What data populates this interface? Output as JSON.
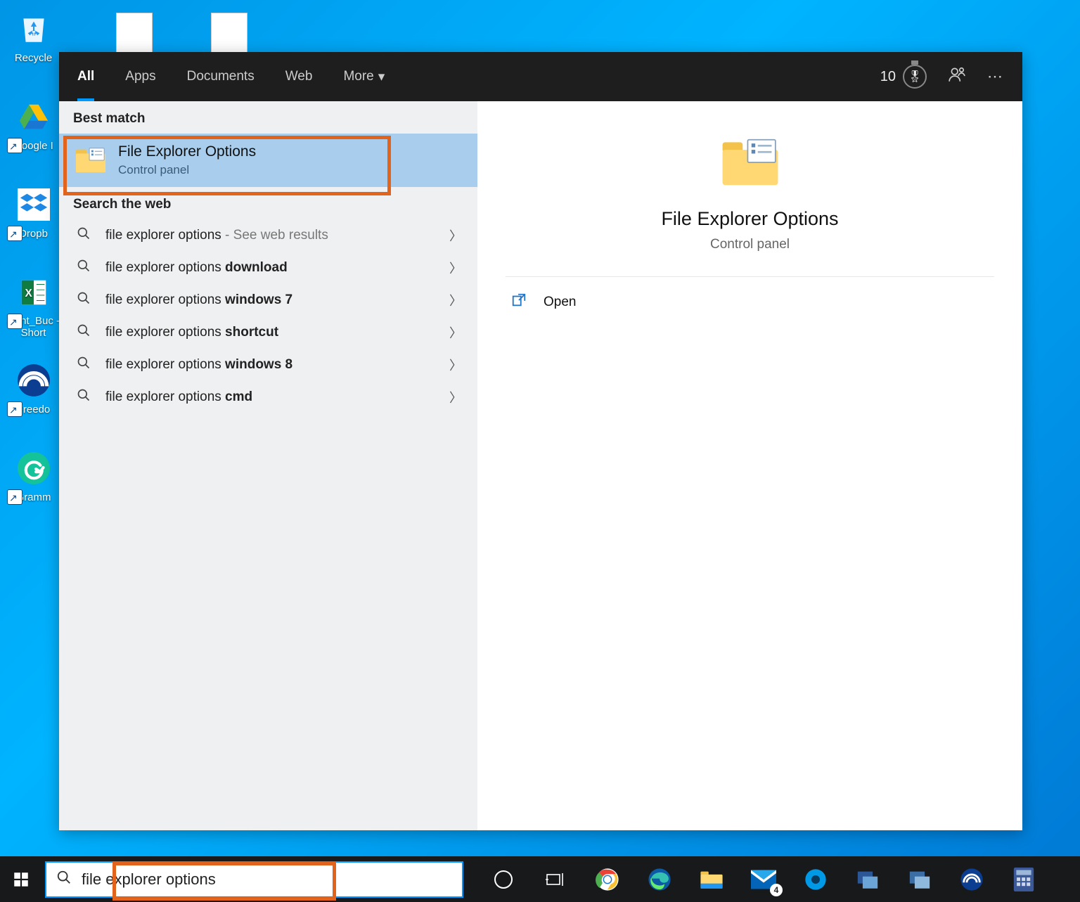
{
  "desktop": {
    "icons": [
      {
        "label": "Recycle",
        "glyph": "recycle"
      },
      {
        "label": "Google I",
        "glyph": "gdrive"
      },
      {
        "label": "Dropb",
        "glyph": "dropbox"
      },
      {
        "label": "Joint_Buc - Short",
        "glyph": "excel"
      },
      {
        "label": "Freedo",
        "glyph": "freedome"
      },
      {
        "label": "Gramm",
        "glyph": "grammarly"
      }
    ]
  },
  "flyout": {
    "tabs": {
      "all": "All",
      "apps": "Apps",
      "documents": "Documents",
      "web": "Web",
      "more": "More"
    },
    "points": "10",
    "sections": {
      "best_match": "Best match",
      "search_web": "Search the web"
    },
    "best_match": {
      "title": "File Explorer Options",
      "subtitle": "Control panel"
    },
    "web_results": [
      {
        "prefix": "file explorer options",
        "suffix": "",
        "hint": " - See web results"
      },
      {
        "prefix": "file explorer options ",
        "suffix": "download",
        "hint": ""
      },
      {
        "prefix": "file explorer options ",
        "suffix": "windows 7",
        "hint": ""
      },
      {
        "prefix": "file explorer options ",
        "suffix": "shortcut",
        "hint": ""
      },
      {
        "prefix": "file explorer options ",
        "suffix": "windows 8",
        "hint": ""
      },
      {
        "prefix": "file explorer options ",
        "suffix": "cmd",
        "hint": ""
      }
    ],
    "detail": {
      "title": "File Explorer Options",
      "subtitle": "Control panel",
      "open_label": "Open"
    }
  },
  "taskbar": {
    "search_value": "file explorer options",
    "mail_badge": "4"
  }
}
